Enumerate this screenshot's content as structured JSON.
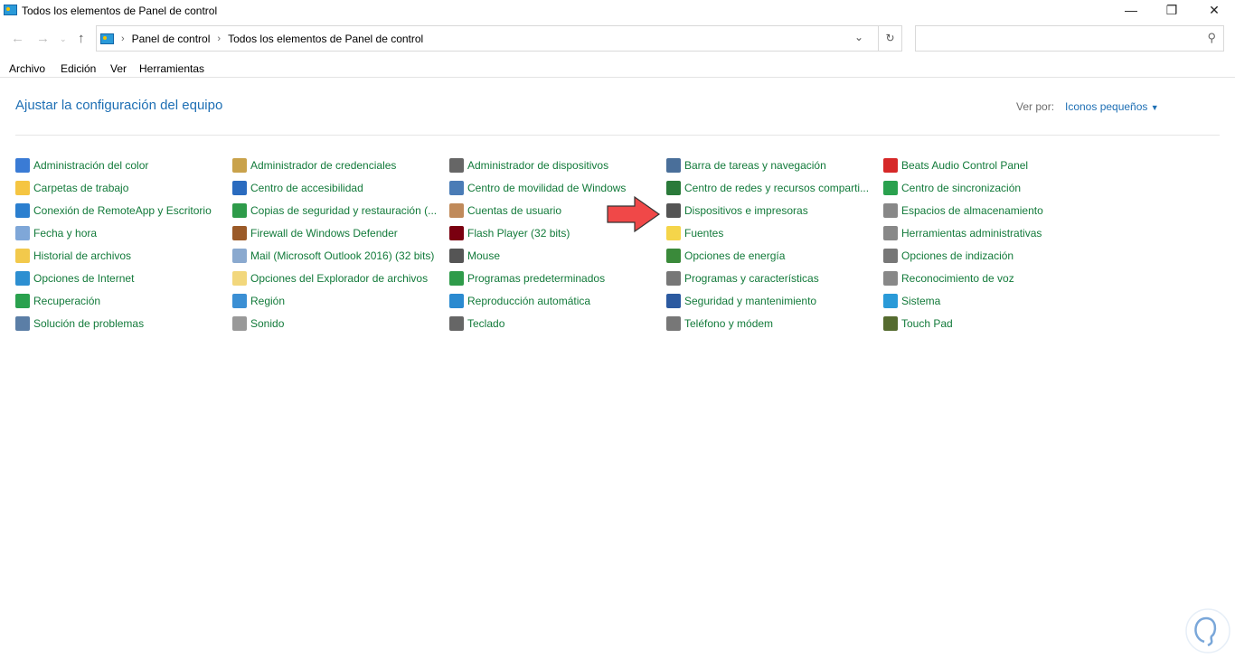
{
  "window": {
    "title": "Todos los elementos de Panel de control"
  },
  "breadcrumb": [
    "Panel de control",
    "Todos los elementos de Panel de control"
  ],
  "search": {
    "placeholder": ""
  },
  "menu": [
    "Archivo",
    "Edición",
    "Ver",
    "Herramientas"
  ],
  "main": {
    "heading": "Ajustar la configuración del equipo",
    "view_by_label": "Ver por:",
    "view_by_value": "Iconos pequeños"
  },
  "columns": [
    [
      "Administración del color",
      "Carpetas de trabajo",
      "Conexión de RemoteApp y Escritorio",
      "Fecha y hora",
      "Historial de archivos",
      "Opciones de Internet",
      "Recuperación",
      "Solución de problemas"
    ],
    [
      "Administrador de credenciales",
      "Centro de accesibilidad",
      "Copias de seguridad y restauración (...",
      "Firewall de Windows Defender",
      "Mail (Microsoft Outlook 2016) (32 bits)",
      "Opciones del Explorador de archivos",
      "Región",
      "Sonido"
    ],
    [
      "Administrador de dispositivos",
      "Centro de movilidad de Windows",
      "Cuentas de usuario",
      "Flash Player (32 bits)",
      "Mouse",
      "Programas predeterminados",
      "Reproducción automática",
      "Teclado"
    ],
    [
      "Barra de tareas y navegación",
      "Centro de redes y recursos comparti...",
      "Dispositivos e impresoras",
      "Fuentes",
      "Opciones de energía",
      "Programas y características",
      "Seguridad y mantenimiento",
      "Teléfono y módem"
    ],
    [
      "Beats Audio Control Panel",
      "Centro de sincronización",
      "Espacios de almacenamiento",
      "Herramientas administrativas",
      "Opciones de indización",
      "Reconocimiento de voz",
      "Sistema",
      "Touch Pad"
    ]
  ],
  "colors": {
    "link": "#127a3a",
    "heading": "#1e6fb4",
    "arrow": "#f04848"
  }
}
